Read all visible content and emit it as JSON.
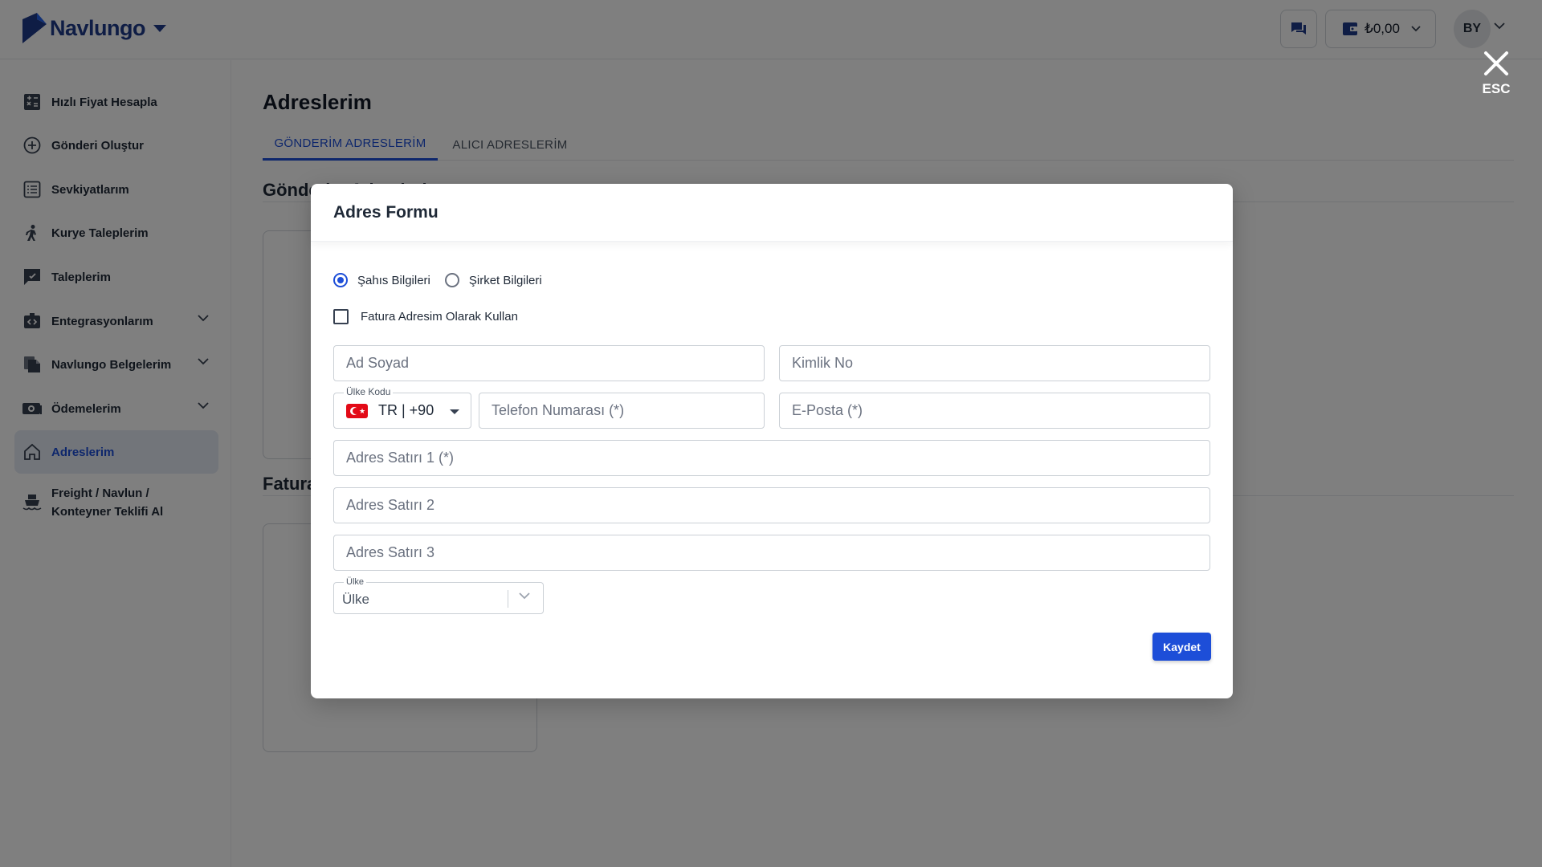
{
  "brand": {
    "name": "Navlungo",
    "color": "#1e3a8a",
    "accent": "#1d4ed8"
  },
  "topbar": {
    "messages_icon": "chat-icon",
    "wallet": {
      "icon": "wallet-icon",
      "amount": "₺0,00"
    },
    "user": {
      "initials": "BY"
    }
  },
  "sidebar": {
    "items": [
      {
        "label": "Hızlı Fiyat Hesapla",
        "icon": "calculator-icon"
      },
      {
        "label": "Gönderi Oluştur",
        "icon": "plus-circle-icon"
      },
      {
        "label": "Sevkiyatlarım",
        "icon": "list-icon"
      },
      {
        "label": "Kurye Taleplerim",
        "icon": "courier-icon"
      },
      {
        "label": "Taleplerim",
        "icon": "request-icon"
      },
      {
        "label": "Entegrasyonlarım",
        "icon": "integration-icon",
        "expandable": true
      },
      {
        "label": "Navlungo Belgelerim",
        "icon": "documents-icon",
        "expandable": true
      },
      {
        "label": "Ödemelerim",
        "icon": "payment-icon",
        "expandable": true
      },
      {
        "label": "Adreslerim",
        "icon": "home-icon",
        "active": true
      },
      {
        "label": "Freight / Navlun / Konteyner Teklifi Al",
        "icon": "ship-icon"
      }
    ]
  },
  "main": {
    "title": "Adreslerim",
    "tabs": [
      {
        "label": "GÖNDERİM ADRESLERİM",
        "active": true
      },
      {
        "label": "ALICI ADRESLERİM",
        "active": false
      }
    ],
    "sections": [
      {
        "title": "Gönderim Adreslerim"
      },
      {
        "title": "Fatura Adreslerim"
      }
    ]
  },
  "esc": {
    "label": "ESC",
    "icon": "close-icon"
  },
  "modal": {
    "title": "Adres Formu",
    "radios": [
      {
        "label": "Şahıs Bilgileri",
        "checked": true
      },
      {
        "label": "Şirket Bilgileri",
        "checked": false
      }
    ],
    "checkbox": {
      "label": "Fatura Adresim Olarak Kullan",
      "checked": false
    },
    "fields": {
      "name": {
        "placeholder": "Ad Soyad",
        "value": ""
      },
      "id_no": {
        "placeholder": "Kimlik No",
        "value": ""
      },
      "country_code": {
        "legend": "Ülke Kodu",
        "value": "TR | +90"
      },
      "phone": {
        "placeholder": "Telefon Numarası (*)",
        "value": ""
      },
      "email": {
        "placeholder": "E-Posta (*)",
        "value": ""
      },
      "address1": {
        "placeholder": "Adres Satırı 1 (*)",
        "value": ""
      },
      "address2": {
        "placeholder": "Adres Satırı 2",
        "value": ""
      },
      "address3": {
        "placeholder": "Adres Satırı 3",
        "value": ""
      },
      "country": {
        "legend": "Ülke",
        "value": "Ülke"
      }
    },
    "save_label": "Kaydet"
  }
}
